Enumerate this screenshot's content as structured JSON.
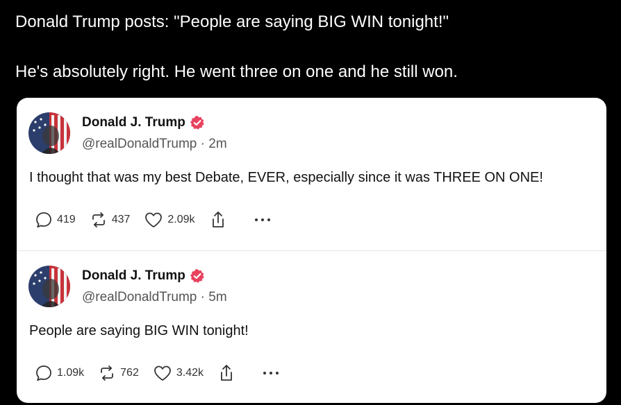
{
  "caption": {
    "line1": "Donald Trump posts: \"People are saying BIG WIN tonight!\"",
    "line2": "He's absolutely right. He went three on one and he still won."
  },
  "posts": [
    {
      "author": "Donald J. Trump",
      "handle": "@realDonaldTrump · 2m",
      "text": "I thought that was my best Debate, EVER, especially since it was THREE ON ONE!",
      "replies": "419",
      "reposts": "437",
      "likes": "2.09k",
      "verified_badge_color": "#e8425f"
    },
    {
      "author": "Donald J. Trump",
      "handle": "@realDonaldTrump · 5m",
      "text": "People are saying BIG WIN tonight!",
      "replies": "1.09k",
      "reposts": "762",
      "likes": "3.42k",
      "verified_badge_color": "#e8425f"
    }
  ],
  "icons": [
    "reply-icon",
    "repost-icon",
    "like-icon",
    "share-icon",
    "more-icon",
    "verified-badge-icon"
  ]
}
